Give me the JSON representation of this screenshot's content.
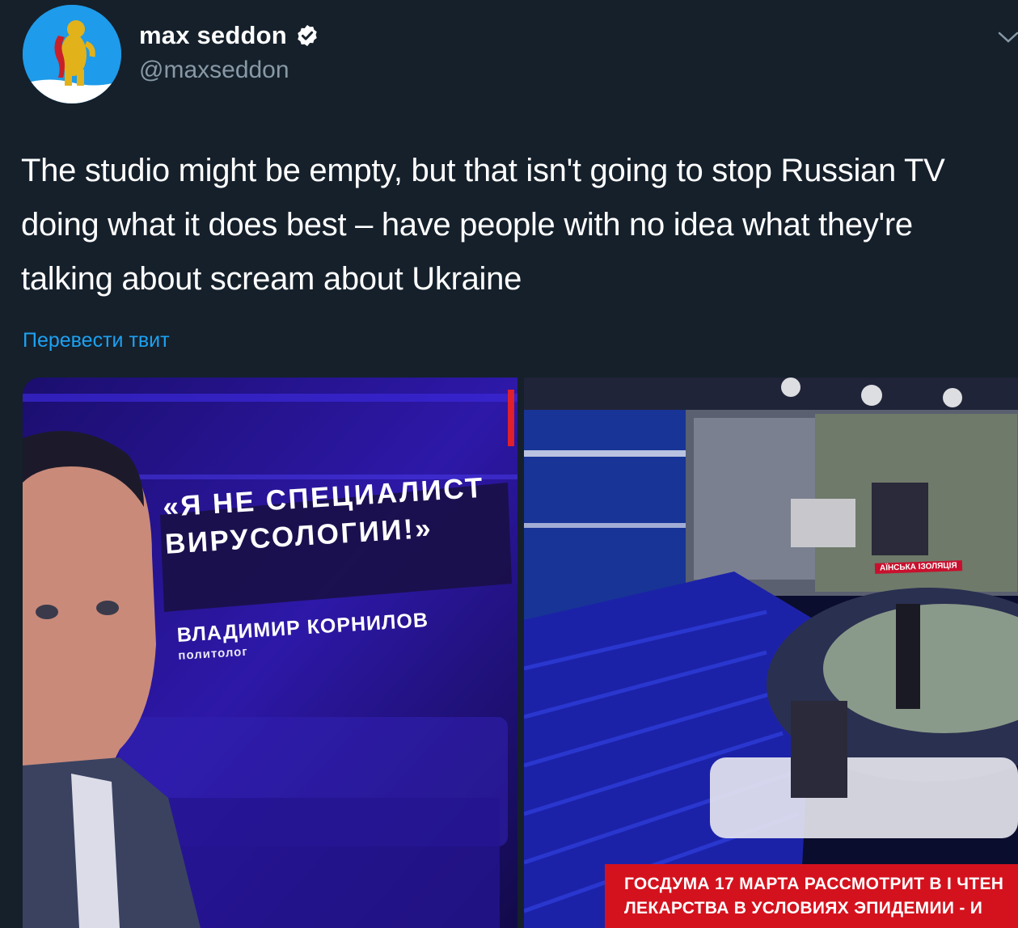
{
  "author": {
    "display_name": "max seddon",
    "handle": "@maxseddon",
    "verified_icon": "verified-badge-icon",
    "avatar_icon": "bear-coat-of-arms-avatar"
  },
  "tweet": {
    "text": "The studio might be empty, but that isn't going to stop Russian TV doing what it does best – have people with no idea what they're talking about scream about Ukraine",
    "translate_link": "Перевести твит"
  },
  "media": {
    "left_image": {
      "quote_line1": "«Я НЕ СПЕЦИАЛИСТ",
      "quote_line2": "ВИРУСОЛОГИИ!»",
      "speaker_name": "ВЛАДИМИР КОРНИЛОВ",
      "speaker_role": "политолог"
    },
    "right_image": {
      "screen_caption": "АЇНСЬКА ІЗОЛЯЦІЯ",
      "ticker_line1": "ГОСДУМА 17 МАРТА РАССМОТРИТ В I ЧТЕН",
      "ticker_line2": "ЛЕКАРСТВА В УСЛОВИЯХ ЭПИДЕМИИ - И"
    }
  },
  "colors": {
    "background": "#15202b",
    "secondary_text": "#8899a6",
    "link": "#1da1f2",
    "ticker_red": "#d4121e"
  }
}
